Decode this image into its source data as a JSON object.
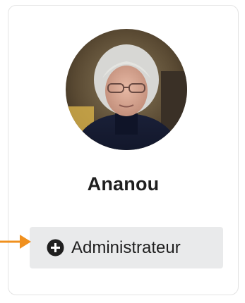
{
  "profile": {
    "name": "Ananou",
    "role_label": "Administrateur",
    "role_icon": "plus-circle-icon"
  },
  "annotation": {
    "arrow_icon": "arrow-right-icon",
    "arrow_color": "#f0901e"
  },
  "colors": {
    "button_bg": "#e9eaeb",
    "text": "#1f1f1f",
    "card_border": "#e3e3e3"
  }
}
